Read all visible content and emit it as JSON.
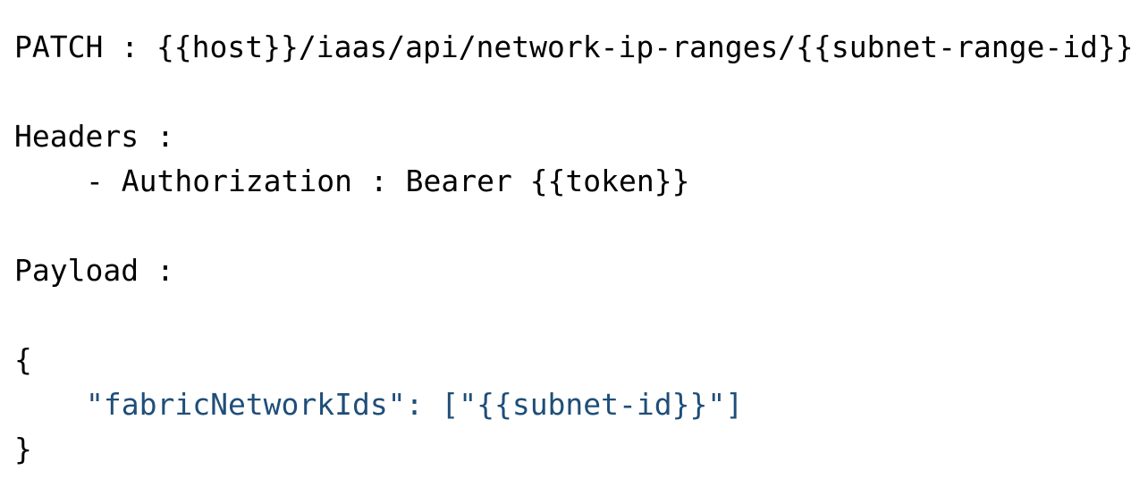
{
  "document": {
    "background_color": "#ffffff",
    "text_color": "#000000",
    "accent_color": "#1f4e79",
    "font_size_px": 33,
    "line_height_px": 50
  },
  "lines": [
    {
      "id": "request-line",
      "indent": 0,
      "color": "#000000",
      "text": "PATCH : {{host}}/iaas/api/network-ip-ranges/{{subnet-range-id}}"
    },
    {
      "id": "blank-1",
      "indent": 0,
      "color": "#000000",
      "text": " "
    },
    {
      "id": "headers-label",
      "indent": 0,
      "color": "#000000",
      "text": "Headers :"
    },
    {
      "id": "header-authorization",
      "indent": 4,
      "color": "#000000",
      "text": "- Authorization : Bearer {{token}}"
    },
    {
      "id": "blank-2",
      "indent": 0,
      "color": "#000000",
      "text": " "
    },
    {
      "id": "payload-label",
      "indent": 0,
      "color": "#000000",
      "text": "Payload :"
    },
    {
      "id": "blank-3",
      "indent": 0,
      "color": "#000000",
      "text": " "
    },
    {
      "id": "payload-open-brace",
      "indent": 0,
      "color": "#000000",
      "text": "{"
    },
    {
      "id": "payload-body",
      "indent": 4,
      "color": "#1f4e79",
      "text": "\"fabricNetworkIds\": [\"{{subnet-id}}\"]"
    },
    {
      "id": "payload-close-brace",
      "indent": 0,
      "color": "#000000",
      "text": "}"
    }
  ],
  "request": {
    "method": "PATCH",
    "separator": ":",
    "url": "{{host}}/iaas/api/network-ip-ranges/{{subnet-range-id}}",
    "host_variable": "{{host}}",
    "path": "/iaas/api/network-ip-ranges/",
    "path_variable": "{{subnet-range-id}}"
  },
  "headers": {
    "label": "Headers :",
    "items": [
      {
        "bullet": "-",
        "name": "Authorization",
        "separator": ":",
        "scheme": "Bearer",
        "value_variable": "{{token}}",
        "full": "- Authorization : Bearer {{token}}"
      }
    ]
  },
  "payload": {
    "label": "Payload :",
    "open_brace": "{",
    "close_brace": "}",
    "key": "\"fabricNetworkIds\"",
    "key_separator": ":",
    "value": "[\"{{subnet-id}}\"]",
    "value_variable": "{{subnet-id}}",
    "body_line": "\"fabricNetworkIds\": [\"{{subnet-id}}\"]",
    "raw": "{\n    \"fabricNetworkIds\": [\"{{subnet-id}}\"]\n}"
  }
}
